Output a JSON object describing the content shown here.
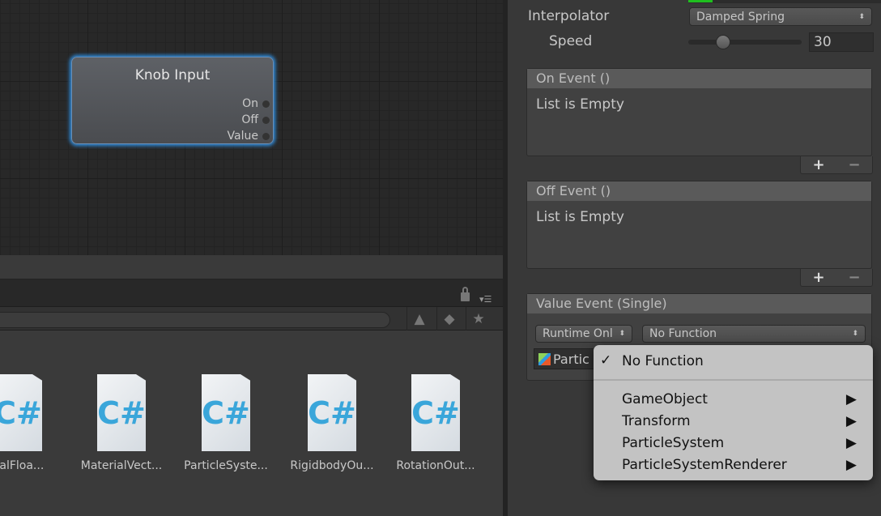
{
  "node": {
    "title": "Knob Input",
    "ports": [
      "On",
      "Off",
      "Value"
    ]
  },
  "project": {
    "assets": [
      "rialFloa...",
      "MaterialVect...",
      "ParticleSyste...",
      "RigidbodyOu...",
      "RotationOut..."
    ],
    "asset_icon": "csharp-script-icon",
    "icon_text": "C#"
  },
  "inspector": {
    "interpolator_label": "Interpolator",
    "interpolator_value": "Damped Spring",
    "speed_label": "Speed",
    "speed_value": "30",
    "speed_fraction": 0.22,
    "on_event": {
      "title": "On Event ()",
      "body": "List is Empty"
    },
    "off_event": {
      "title": "Off Event ()",
      "body": "List is Empty"
    },
    "value_event": {
      "title": "Value Event (Single)",
      "runtime": "Runtime Onl",
      "function": "No Function",
      "object": "Partic"
    },
    "plus": "+",
    "minus": "−"
  },
  "menu": {
    "check": "✓",
    "selected": "No Function",
    "items": [
      "GameObject",
      "Transform",
      "ParticleSystem",
      "ParticleSystemRenderer"
    ],
    "arrow": "▶"
  },
  "colors": {
    "node_glow": "#2e8ee0",
    "csharp": "#3aa6da",
    "accent_green": "#1fbf1f"
  }
}
